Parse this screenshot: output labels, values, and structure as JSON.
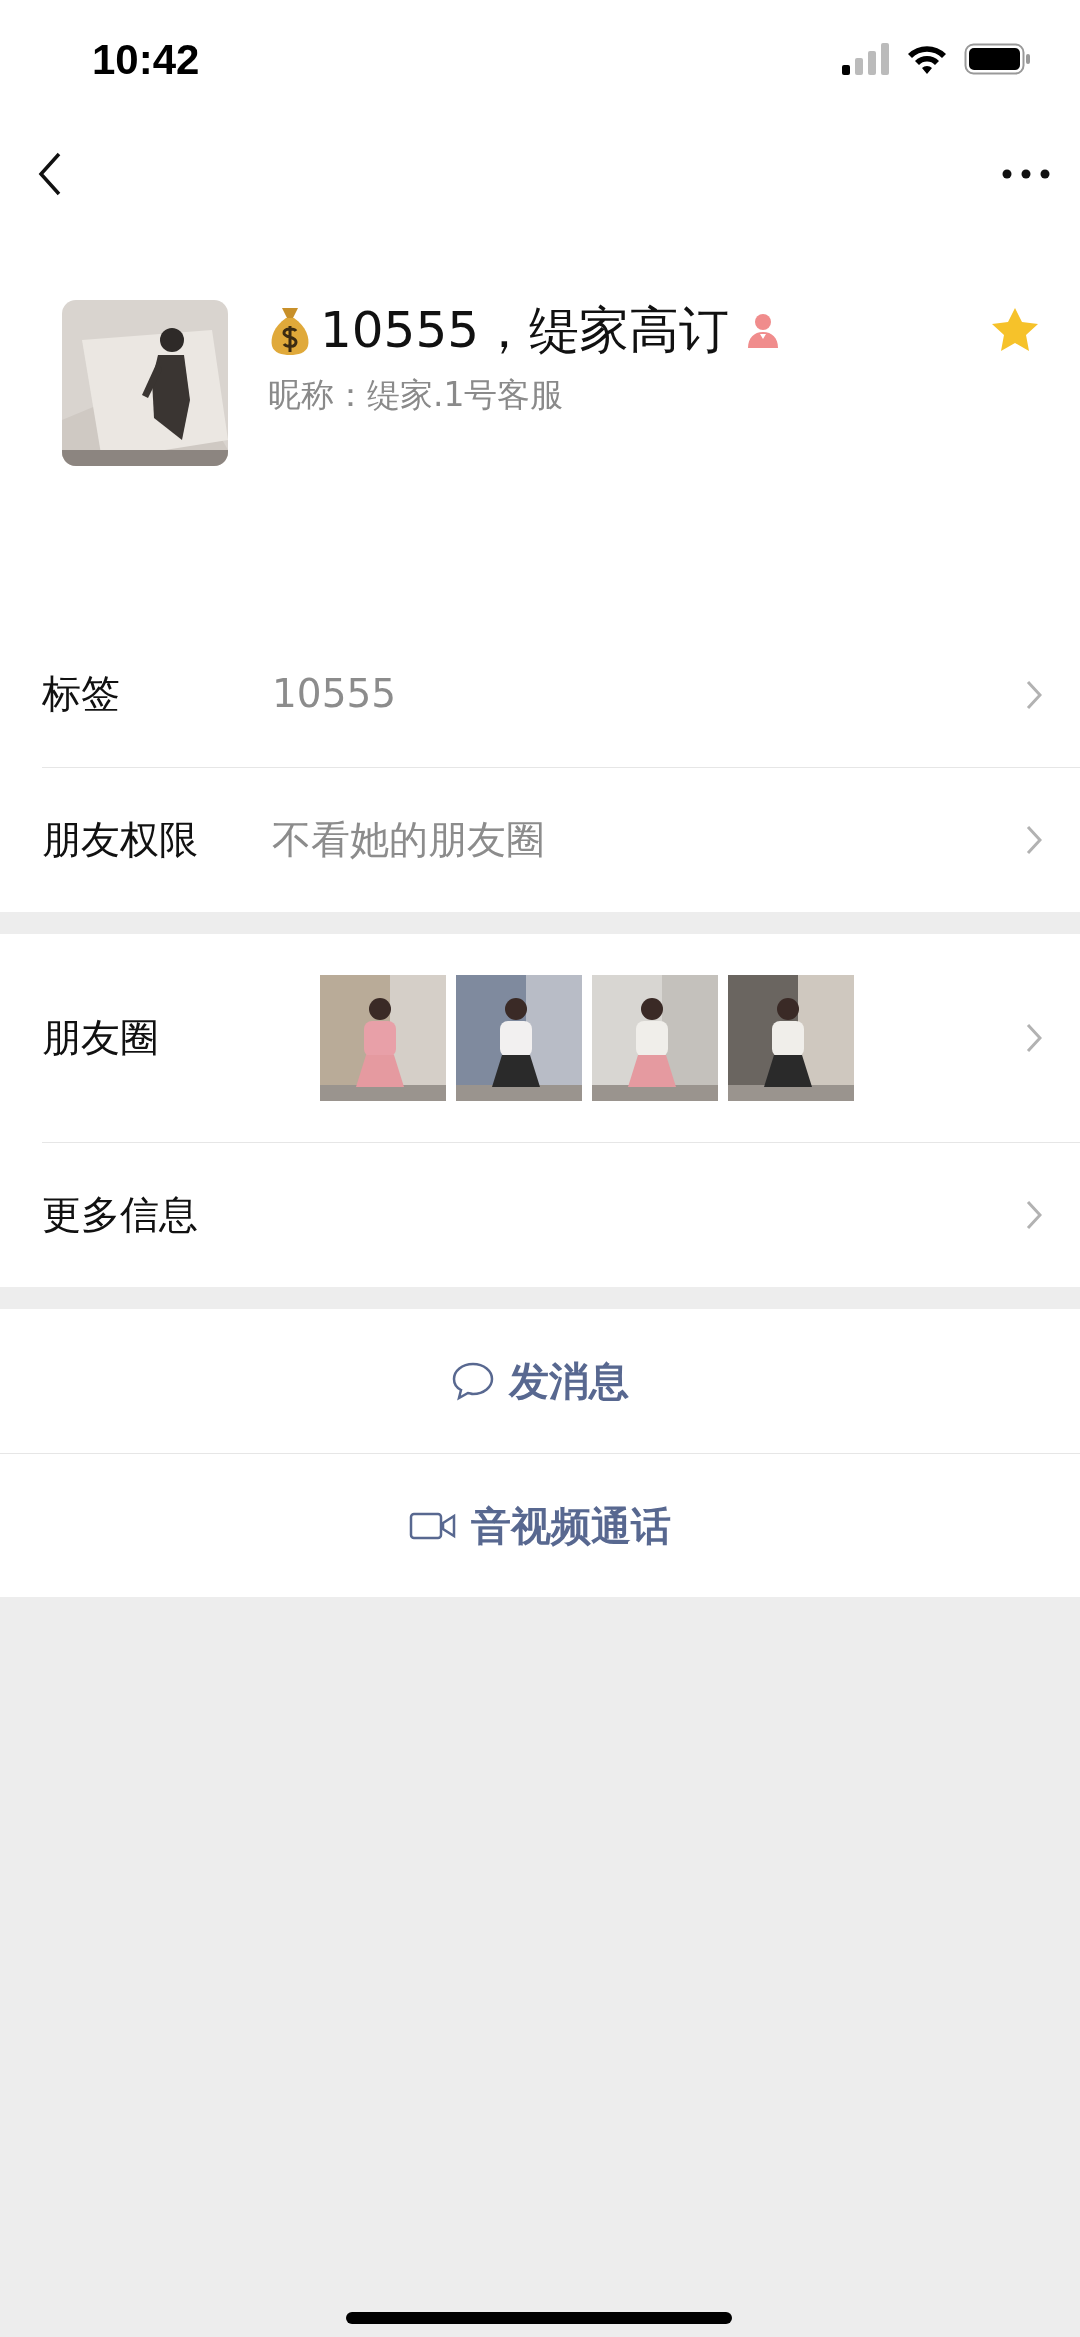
{
  "status_bar": {
    "time": "10:42"
  },
  "profile": {
    "name": "10555，缇家高订",
    "nickname": "昵称：缇家.1号客服",
    "starred": true
  },
  "info_rows": [
    {
      "label": "标签",
      "value": "10555"
    },
    {
      "label": "朋友权限",
      "value": "不看她的朋友圈"
    }
  ],
  "moments": {
    "label": "朋友圈"
  },
  "more_row": {
    "label": "更多信息"
  },
  "actions": [
    {
      "kind": "message",
      "label": "发消息"
    },
    {
      "kind": "call",
      "label": "音视频通话"
    }
  ]
}
